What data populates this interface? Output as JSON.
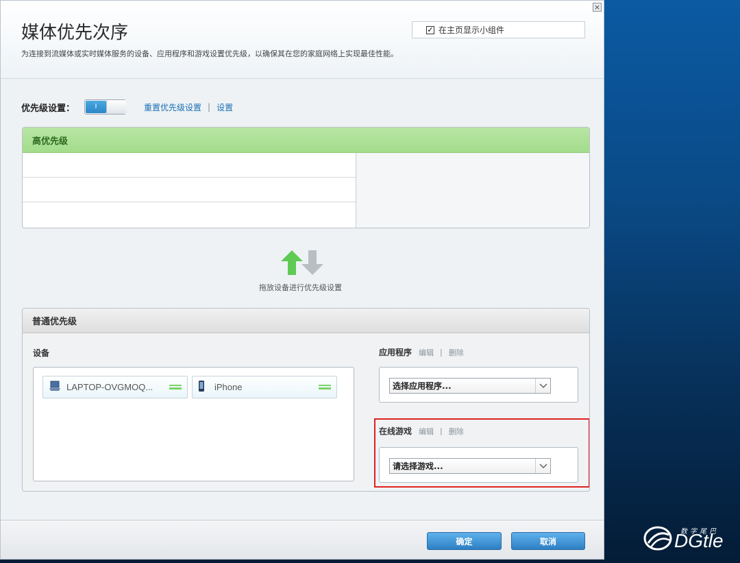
{
  "dialog": {
    "title": "媒体优先次序",
    "description": "为连接到流媒体或实时媒体服务的设备、应用程序和游戏设置优先级，以确保其在您的家庭网络上实现最佳性能。",
    "show_widget_label": "在主页显示小组件",
    "show_widget_checked": true,
    "close_symbol": "×"
  },
  "priority_settings": {
    "label": "优先级设置：",
    "switch_state": "I",
    "reset_link": "重置优先级设置",
    "separator": "|",
    "settings_link": "设置"
  },
  "high_priority": {
    "title": "高优先级"
  },
  "drag_hint": "拖放设备进行优先级设置",
  "normal_priority": {
    "title": "普通优先级",
    "devices_label": "设备",
    "devices": [
      {
        "name": "LAPTOP-OVGMOQ...",
        "icon": "laptop-icon"
      },
      {
        "name": "iPhone",
        "icon": "phone-icon"
      }
    ],
    "apps": {
      "title": "应用程序",
      "edit": "编辑",
      "separator": "|",
      "delete": "删除",
      "select_value": "选择应用程序..."
    },
    "games": {
      "title": "在线游戏",
      "edit": "编辑",
      "separator": "|",
      "delete": "删除",
      "select_value": "请选择游戏..."
    }
  },
  "footer": {
    "ok": "确定",
    "cancel": "取消"
  },
  "watermark": {
    "small": "数字尾巴",
    "brand": "DGtle"
  },
  "colors": {
    "accent": "#2d7fc3",
    "high_header": "#a3dc8c",
    "highlight": "#e02020"
  }
}
